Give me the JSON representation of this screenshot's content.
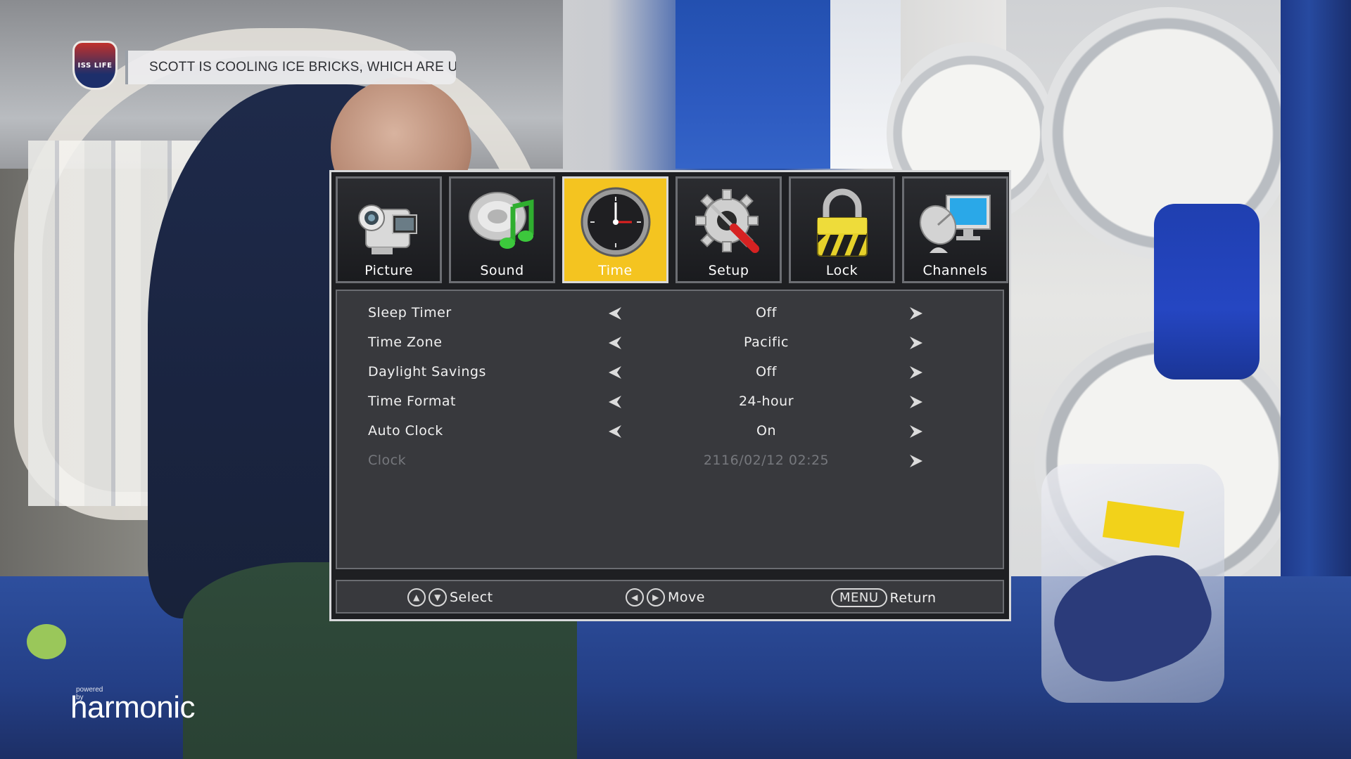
{
  "ticker": {
    "badge_text": "ISS LIFE",
    "text": "SCOTT IS COOLING ICE BRICKS, WHICH ARE USE"
  },
  "branding": {
    "powered_by": "powered by",
    "name": "harmonic"
  },
  "menu": {
    "tabs": [
      {
        "label": "Picture",
        "icon": "camcorder-icon",
        "active": false
      },
      {
        "label": "Sound",
        "icon": "speaker-note-icon",
        "active": false
      },
      {
        "label": "Time",
        "icon": "clock-icon",
        "active": true
      },
      {
        "label": "Setup",
        "icon": "gear-screwdriver-icon",
        "active": false
      },
      {
        "label": "Lock",
        "icon": "padlock-icon",
        "active": false
      },
      {
        "label": "Channels",
        "icon": "satellite-monitor-icon",
        "active": false
      }
    ],
    "rows": [
      {
        "label": "Sleep Timer",
        "value": "Off",
        "enabled": true
      },
      {
        "label": "Time Zone",
        "value": "Pacific",
        "enabled": true
      },
      {
        "label": "Daylight Savings",
        "value": "Off",
        "enabled": true
      },
      {
        "label": "Time Format",
        "value": "24-hour",
        "enabled": true
      },
      {
        "label": "Auto Clock",
        "value": "On",
        "enabled": true
      },
      {
        "label": "Clock",
        "value": "2116/02/12 02:25",
        "enabled": false
      }
    ],
    "footer": {
      "select": "Select",
      "move": "Move",
      "menu_key": "MENU",
      "return": "Return"
    },
    "colors": {
      "active_tab": "#f4c420",
      "panel": "#38393d",
      "frame": "#1e1f22"
    }
  }
}
